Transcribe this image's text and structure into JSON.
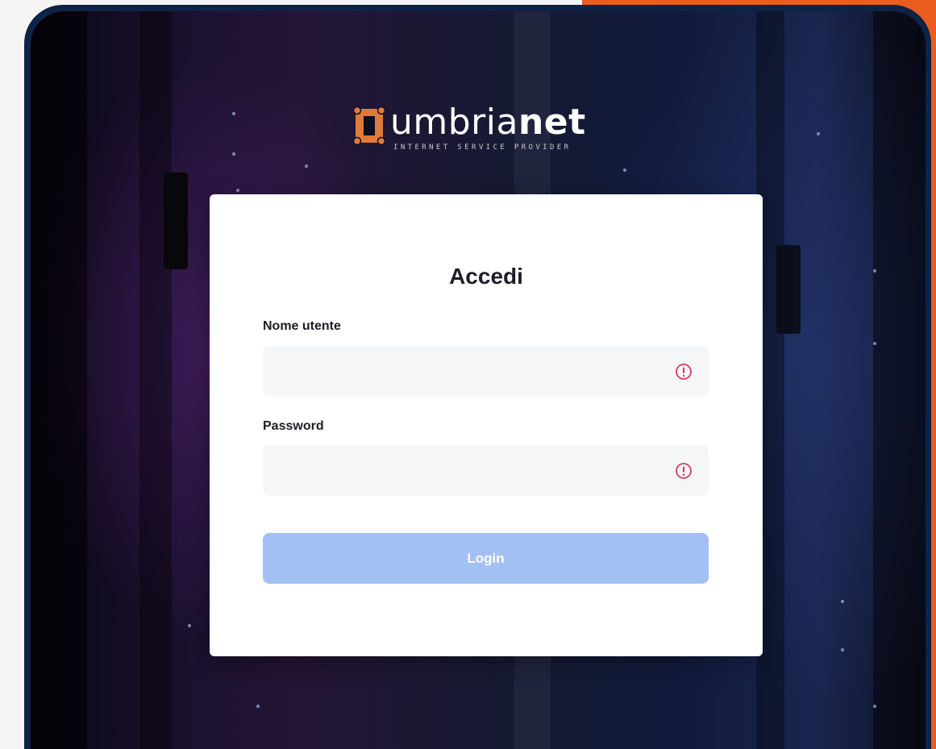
{
  "brand": {
    "name_light": "umbria",
    "name_bold": "net",
    "tagline": "INTERNET SERVICE PROVIDER",
    "accent_color": "#ea5d1f"
  },
  "login": {
    "title": "Accedi",
    "username": {
      "label": "Nome utente",
      "value": "",
      "placeholder": "",
      "status_icon": "error-circle-icon"
    },
    "password": {
      "label": "Password",
      "value": "",
      "placeholder": "",
      "status_icon": "error-circle-icon"
    },
    "submit_label": "Login",
    "submit_color": "#a3c0f4",
    "error_color": "#d93a5b"
  }
}
